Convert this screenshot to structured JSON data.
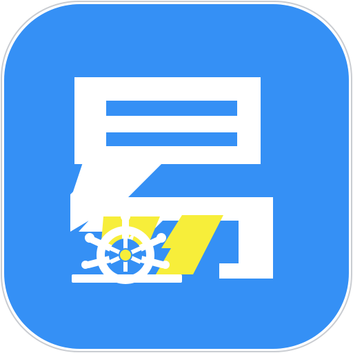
{
  "app_icon": {
    "logo_glyph": "易",
    "icon_names": [
      "ship-wheel-icon"
    ],
    "colors": {
      "background_blue": "#3590F5",
      "glyph_white": "#FFFFFF",
      "accent_yellow": "#F7EE3A",
      "outline_grey": "#C9CCD1",
      "wheel_hub_yellow": "#F7EE3A"
    }
  }
}
